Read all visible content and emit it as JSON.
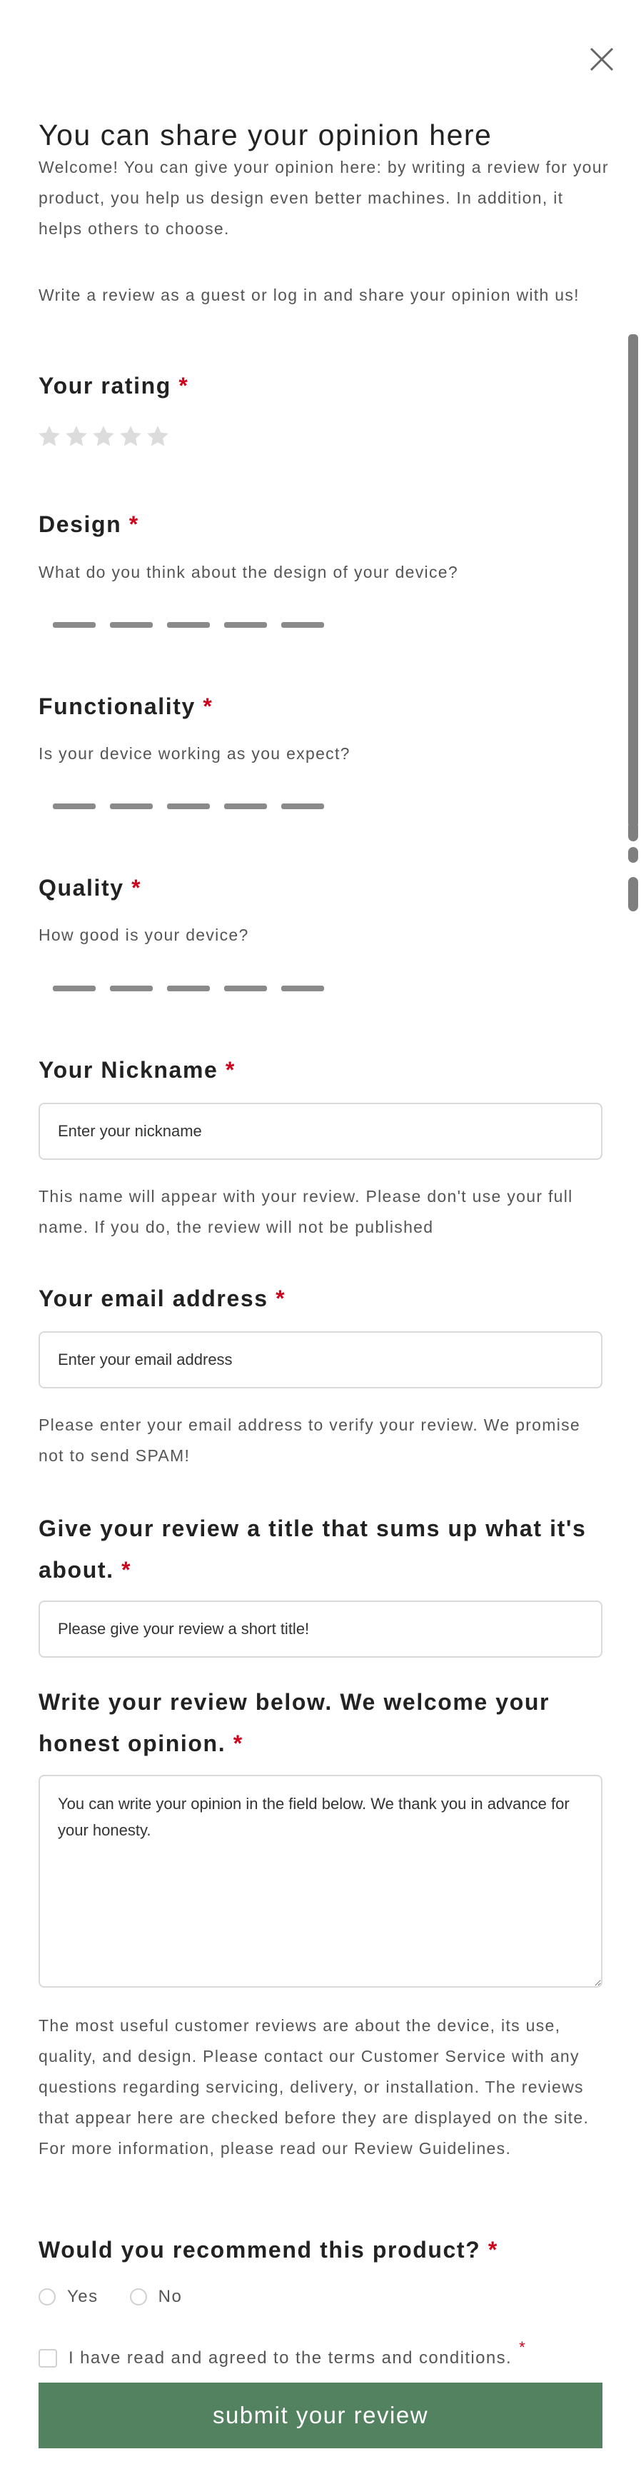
{
  "modal": {
    "title": "You can share your opinion here",
    "intro": "Welcome! You can give your opinion here: by writing a review for your product, you help us design even better machines. In addition, it helps others to choose.",
    "guest_note": "Write a review as a guest or log in and share your opinion with us!"
  },
  "required_mark": "*",
  "rating": {
    "label": "Your rating",
    "max_stars": 5,
    "value": 0
  },
  "design": {
    "label": "Design",
    "question": "What do you think about the design of your device?",
    "scale_steps": 5
  },
  "functionality": {
    "label": "Functionality",
    "question": "Is your device working as you expect?",
    "scale_steps": 5
  },
  "quality": {
    "label": "Quality",
    "question": "How good is your device?",
    "scale_steps": 5
  },
  "nickname": {
    "label": "Your Nickname",
    "placeholder": "Enter your nickname",
    "value": "",
    "help": "This name will appear with your review. Please don't use your full name. If you do, the review will not be published"
  },
  "email": {
    "label": "Your email address",
    "placeholder": "Enter your email address",
    "value": "",
    "help": "Please enter your email address to verify your review. We promise not to send SPAM!"
  },
  "review_title": {
    "label": "Give your review a title that sums up what it's about.",
    "placeholder": "Please give your review a short title!",
    "value": ""
  },
  "review_body": {
    "label": "Write your review below. We welcome your honest opinion.",
    "placeholder": "You can write your opinion in the field below. We thank you in advance for your honesty.",
    "value": ""
  },
  "guidelines": "The most useful customer reviews are about the device, its use, quality, and design. Please contact our Customer Service with any questions regarding servicing, delivery, or installation. The reviews that appear here are checked before they are displayed on the site. For more information, please read our Review Guidelines.",
  "recommend": {
    "label": "Would you recommend this product?",
    "options": [
      "Yes",
      "No"
    ],
    "selected": null
  },
  "terms": {
    "label": "I have read and agreed to the terms and conditions.",
    "checked": false
  },
  "submit_label": "submit your review",
  "colors": {
    "accent": "#538260",
    "required": "#d0021b",
    "star_empty": "#dcdcdc",
    "dash": "#8a8a8a",
    "scrollbar": "#7f7f7f",
    "text_muted": "#555555"
  },
  "icons": {
    "close": "close-icon",
    "star": "star-icon"
  }
}
